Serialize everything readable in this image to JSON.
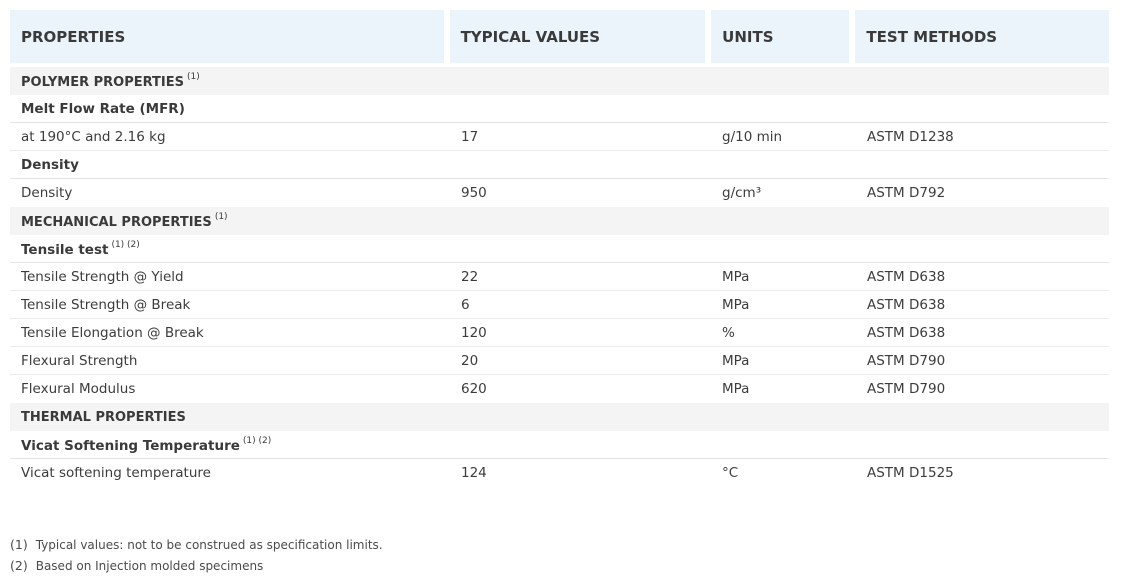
{
  "header": {
    "properties": "PROPERTIES",
    "typical_values": "TYPICAL VALUES",
    "units": "UNITS",
    "test_methods": "TEST METHODS"
  },
  "sections": {
    "polymer": {
      "title": "POLYMER PROPERTIES",
      "fn": "(1)"
    },
    "mfr_sub": {
      "title": "Melt Flow Rate (MFR)"
    },
    "mfr_row": {
      "property": "at 190°C and 2.16 kg",
      "value": "17",
      "unit": "g/10 min",
      "method": "ASTM D1238"
    },
    "density_sub": {
      "title": "Density"
    },
    "density_row": {
      "property": "Density",
      "value": "950",
      "unit": "g/cm³",
      "method": "ASTM D792"
    },
    "mechanical": {
      "title": "MECHANICAL PROPERTIES",
      "fn": "(1)"
    },
    "tensile_sub": {
      "title": "Tensile test",
      "fn": "(1) (2)"
    },
    "mech_rows": [
      {
        "property": "Tensile Strength @ Yield",
        "value": "22",
        "unit": "MPa",
        "method": "ASTM D638"
      },
      {
        "property": "Tensile Strength @ Break",
        "value": "6",
        "unit": "MPa",
        "method": "ASTM D638"
      },
      {
        "property": "Tensile Elongation @ Break",
        "value": "120",
        "unit": "%",
        "method": "ASTM D638"
      },
      {
        "property": "Flexural Strength",
        "value": "20",
        "unit": "MPa",
        "method": "ASTM D790"
      },
      {
        "property": "Flexural Modulus",
        "value": "620",
        "unit": "MPa",
        "method": "ASTM D790"
      }
    ],
    "thermal": {
      "title": "THERMAL PROPERTIES"
    },
    "vicat_sub": {
      "title": "Vicat Softening Temperature",
      "fn": "(1) (2)"
    },
    "vicat_row": {
      "property": "Vicat softening temperature",
      "value": "124",
      "unit": "°C",
      "method": "ASTM D1525"
    }
  },
  "footnotes": [
    {
      "mark": "(1)",
      "text": "Typical values: not to be construed as specification limits."
    },
    {
      "mark": "(2)",
      "text": "Based on Injection molded specimens"
    }
  ]
}
